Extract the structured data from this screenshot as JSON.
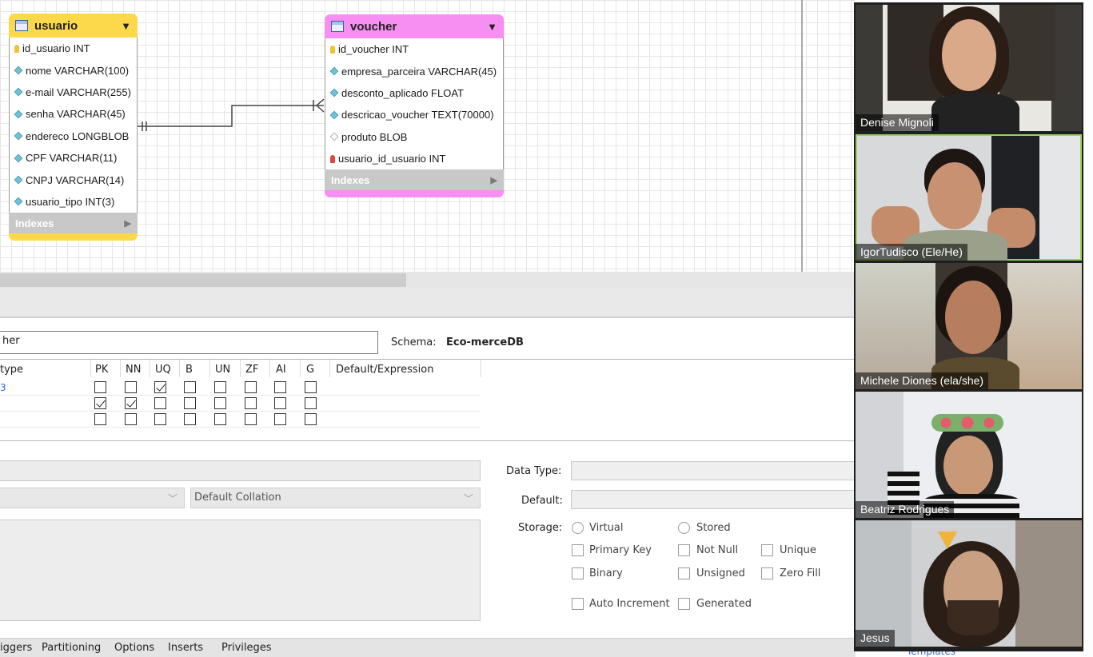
{
  "diagram": {
    "usuario": {
      "title": "usuario",
      "columns": [
        {
          "icon": "primary-key-icon",
          "text": "id_usuario INT"
        },
        {
          "icon": "column-diamond-icon",
          "text": "nome VARCHAR(100)"
        },
        {
          "icon": "column-diamond-icon",
          "text": "e-mail VARCHAR(255)"
        },
        {
          "icon": "column-diamond-icon",
          "text": "senha VARCHAR(45)"
        },
        {
          "icon": "column-diamond-icon",
          "text": "endereco LONGBLOB"
        },
        {
          "icon": "column-diamond-icon",
          "text": "CPF VARCHAR(11)"
        },
        {
          "icon": "column-diamond-icon",
          "text": "CNPJ VARCHAR(14)"
        },
        {
          "icon": "column-diamond-icon",
          "text": "usuario_tipo INT(3)"
        }
      ],
      "indexes_label": "Indexes",
      "color": "#fcd94a"
    },
    "voucher": {
      "title": "voucher",
      "columns": [
        {
          "icon": "primary-key-icon",
          "text": "id_voucher INT"
        },
        {
          "icon": "column-diamond-icon",
          "text": "empresa_parceira VARCHAR(45)"
        },
        {
          "icon": "column-diamond-icon",
          "text": "desconto_aplicado FLOAT"
        },
        {
          "icon": "column-diamond-icon",
          "text": "descricao_voucher TEXT(70000)"
        },
        {
          "icon": "column-diamond-empty-icon",
          "text": "produto BLOB"
        },
        {
          "icon": "foreign-key-icon",
          "text": "usuario_id_usuario INT"
        }
      ],
      "indexes_label": "Indexes",
      "color": "#f78ef2"
    }
  },
  "editor": {
    "table_name": "her",
    "schema_label": "Schema:",
    "schema_value": "Eco-merceDB",
    "column_headers": [
      "type",
      "PK",
      "NN",
      "UQ",
      "B",
      "UN",
      "ZF",
      "AI",
      "G",
      "Default/Expression"
    ],
    "rows": [
      {
        "type_fragment": "3",
        "flags": [
          false,
          false,
          true,
          false,
          false,
          false,
          false,
          false
        ]
      },
      {
        "type_fragment": "",
        "flags": [
          true,
          true,
          false,
          false,
          false,
          false,
          false,
          false
        ]
      },
      {
        "type_fragment": "",
        "flags": [
          false,
          false,
          false,
          false,
          false,
          false,
          false,
          false
        ]
      }
    ],
    "collation_placeholder": "Default Collation",
    "data_type_label": "Data Type:",
    "default_label": "Default:",
    "storage_label": "Storage:",
    "storage_options": [
      "Virtual",
      "Stored"
    ],
    "checkbox_options": [
      "Primary Key",
      "Not Null",
      "Unique",
      "Binary",
      "Unsigned",
      "Zero Fill",
      "Auto Increment",
      "Generated"
    ]
  },
  "tabs": [
    "iggers",
    "Partitioning",
    "Options",
    "Inserts",
    "Privileges"
  ],
  "side_link": "Templates",
  "participants": [
    {
      "name": "Denise Mignoli",
      "active": false
    },
    {
      "name": "IgorTudisco (Ele/He)",
      "active": true
    },
    {
      "name": "Michele Diones (ela/she)",
      "active": false
    },
    {
      "name": "Beatriz Rodrigues",
      "active": false
    },
    {
      "name": "Jesus",
      "active": false
    }
  ]
}
